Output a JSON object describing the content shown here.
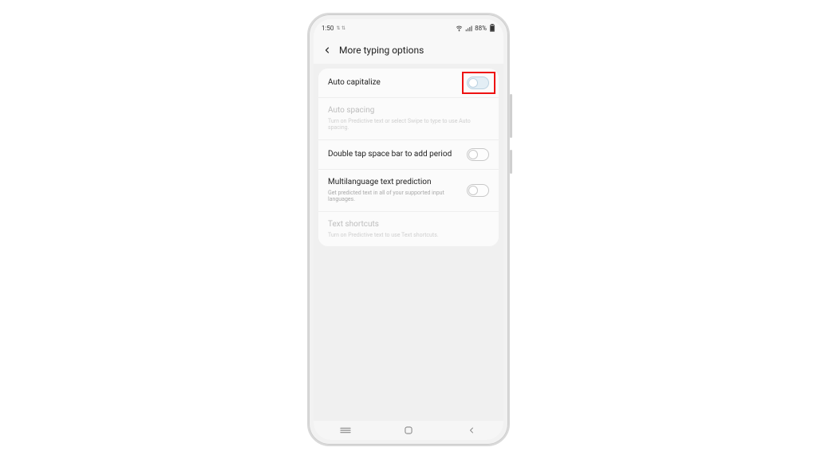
{
  "status": {
    "time": "1:50",
    "indicators_left": "⇅ ⇅",
    "wifi": true,
    "signal": true,
    "battery_pct": "88%"
  },
  "header": {
    "title": "More typing options"
  },
  "rows": {
    "auto_capitalize": {
      "label": "Auto capitalize"
    },
    "auto_spacing": {
      "label": "Auto spacing",
      "sub": "Turn on Predictive text or select Swipe to type to use Auto spacing."
    },
    "double_tap": {
      "label": "Double tap space bar to add period"
    },
    "multilang": {
      "label": "Multilanguage text prediction",
      "sub": "Get predicted text in all of your supported input languages."
    },
    "text_shortcuts": {
      "label": "Text shortcuts",
      "sub": "Turn on Predictive text to use Text shortcuts."
    }
  }
}
